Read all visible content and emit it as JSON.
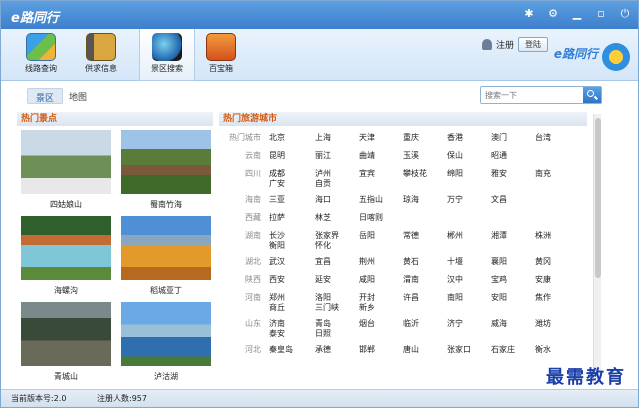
{
  "app": {
    "title": "e路同行",
    "brand": "e路同行"
  },
  "window_controls": [
    "pin",
    "settings",
    "minimize",
    "maximize",
    "close"
  ],
  "toolbar": [
    {
      "id": "route",
      "label": "线路查询",
      "icon": "map-icon"
    },
    {
      "id": "supply",
      "label": "供求信息",
      "icon": "book-icon"
    },
    {
      "id": "scenic",
      "label": "景区搜索",
      "icon": "globe-icon",
      "active": true
    },
    {
      "id": "box",
      "label": "百宝箱",
      "icon": "treasure-box-icon"
    }
  ],
  "user": {
    "register": "注册",
    "login": "登陆"
  },
  "tabs": [
    {
      "label": "景区",
      "active": true
    },
    {
      "label": "地图",
      "active": false
    }
  ],
  "search": {
    "placeholder": "搜索一下"
  },
  "hot_spots": {
    "title": "热门景点",
    "items": [
      {
        "name": "四姑娘山"
      },
      {
        "name": "蜀南竹海"
      },
      {
        "name": "海螺沟"
      },
      {
        "name": "稻城亚丁"
      },
      {
        "name": "青城山"
      },
      {
        "name": "泸沽湖"
      }
    ]
  },
  "hot_cities": {
    "title": "热门旅游城市",
    "rows": [
      {
        "prov": "热门城市",
        "cities": [
          "北京",
          "上海",
          "天津",
          "重庆",
          "香港",
          "澳门",
          "台湾"
        ]
      },
      {
        "prov": "云南",
        "cities": [
          "昆明",
          "丽江",
          "曲靖",
          "玉溪",
          "保山",
          "昭通"
        ]
      },
      {
        "prov": "四川",
        "cities": [
          "成都",
          "泸州",
          "宜宾",
          "攀枝花",
          "绵阳",
          "雅安",
          "南充"
        ],
        "extra": [
          "广安",
          "自贡"
        ]
      },
      {
        "prov": "海南",
        "cities": [
          "三亚",
          "海口",
          "五指山",
          "琼海",
          "万宁",
          "文昌"
        ]
      },
      {
        "prov": "西藏",
        "cities": [
          "拉萨",
          "林芝",
          "日喀则"
        ]
      },
      {
        "prov": "湖南",
        "cities": [
          "长沙",
          "张家界",
          "岳阳",
          "常德",
          "郴州",
          "湘潭",
          "株洲"
        ],
        "extra": [
          "衡阳",
          "怀化"
        ]
      },
      {
        "prov": "湖北",
        "cities": [
          "武汉",
          "宜昌",
          "荆州",
          "黄石",
          "十堰",
          "襄阳",
          "黄冈"
        ]
      },
      {
        "prov": "陕西",
        "cities": [
          "西安",
          "延安",
          "咸阳",
          "渭南",
          "汉中",
          "宝鸡",
          "安康"
        ]
      },
      {
        "prov": "河南",
        "cities": [
          "郑州",
          "洛阳",
          "开封",
          "许昌",
          "南阳",
          "安阳",
          "焦作"
        ],
        "extra": [
          "商丘",
          "三门峡",
          "新乡"
        ]
      },
      {
        "prov": "山东",
        "cities": [
          "济南",
          "青岛",
          "烟台",
          "临沂",
          "济宁",
          "威海",
          "潍坊"
        ],
        "extra": [
          "泰安",
          "日照"
        ]
      },
      {
        "prov": "河北",
        "cities": [
          "秦皇岛",
          "承德",
          "邯郸",
          "唐山",
          "张家口",
          "石家庄",
          "衡水"
        ]
      }
    ]
  },
  "status": {
    "version": "当前版本号:2.0",
    "registered": "注册人数:957"
  },
  "watermark": "最需教育"
}
